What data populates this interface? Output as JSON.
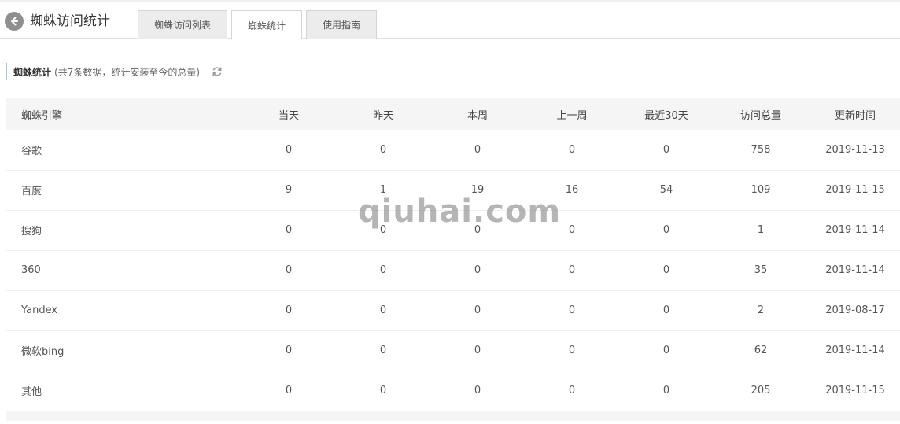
{
  "header": {
    "title": "蜘蛛访问统计",
    "tabs": [
      {
        "label": "蜘蛛访问列表",
        "active": false
      },
      {
        "label": "蜘蛛统计",
        "active": true
      },
      {
        "label": "使用指南",
        "active": false
      }
    ]
  },
  "section": {
    "title": "蜘蛛统计",
    "note": "(共7条数据，统计安装至今的总量)"
  },
  "table": {
    "columns": [
      "蜘蛛引擎",
      "当天",
      "昨天",
      "本周",
      "上一周",
      "最近30天",
      "访问总量",
      "更新时间"
    ],
    "rows": [
      [
        "谷歌",
        "0",
        "0",
        "0",
        "0",
        "0",
        "758",
        "2019-11-13"
      ],
      [
        "百度",
        "9",
        "1",
        "19",
        "16",
        "54",
        "109",
        "2019-11-15"
      ],
      [
        "搜狗",
        "0",
        "0",
        "0",
        "0",
        "0",
        "1",
        "2019-11-14"
      ],
      [
        "360",
        "0",
        "0",
        "0",
        "0",
        "0",
        "35",
        "2019-11-14"
      ],
      [
        "Yandex",
        "0",
        "0",
        "0",
        "0",
        "0",
        "2",
        "2019-08-17"
      ],
      [
        "微软bing",
        "0",
        "0",
        "0",
        "0",
        "0",
        "62",
        "2019-11-14"
      ],
      [
        "其他",
        "0",
        "0",
        "0",
        "0",
        "0",
        "205",
        "2019-11-15"
      ]
    ]
  },
  "watermark": "qiuhai.com",
  "icons": {
    "back": "back-arrow-icon",
    "refresh": "refresh-icon"
  },
  "colors": {
    "accent_border": "#a9c4df",
    "header_bg": "#f5f5f5",
    "back_icon_bg": "#8f8f8f"
  }
}
